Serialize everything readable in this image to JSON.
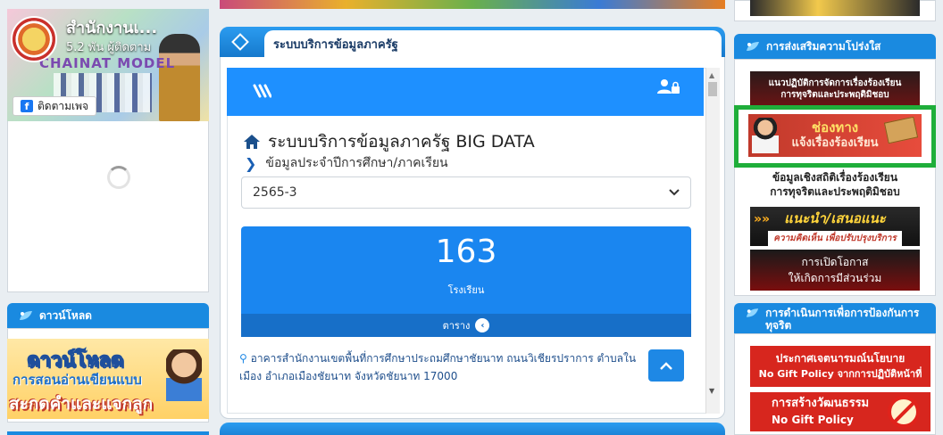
{
  "facebook": {
    "page_name": "สำนักงานเ...",
    "followers": "5.2 พัน ผู้ติดตาม",
    "cover_text": "CHAINAT MODEL",
    "follow_button": "ติดตามเพจ",
    "fb_letter": "f"
  },
  "downloads": {
    "header": "ดาวน์โหลด",
    "banner_line1": "ดาวน์โหลด",
    "banner_line2": "การสอนอ่านเขียนแบบ",
    "banner_line3": "สะกดคำและแจกลูก"
  },
  "main_panel": {
    "header": "ระบบบริการข้อมูลภาครัฐ",
    "app_title": "ระบบบริการข้อมูลภาครัฐ BIG DATA",
    "subtitle": "ข้อมูลประจำปีการศึกษา/ภาคเรียน",
    "select_value": "2565-3",
    "stat": {
      "value": "163",
      "label": "โรงเรียน",
      "footer": "ตาราง"
    },
    "address": "อาคารสำนักงานเขตพื้นที่การศึกษาประถมศึกษาชัยนาท ถนนวิเชียรปราการ ตำบลในเมือง อำเภอเมืองชัยนาท จังหวัดชัยนาท 17000"
  },
  "sidebar_right": {
    "transparency_header": "การส่งเสริมความโปร่งใส",
    "banners": [
      {
        "line1": "แนวปฏิบัติการจัดการเรื่องร้องเรียน",
        "line2": "การทุจริตและประพฤติมิชอบ"
      },
      {
        "line1": "ช่องทาง",
        "line2": "แจ้งเรื่องร้องเรียน"
      },
      {
        "line1": "ข้อมูลเชิงสถิติเรื่องร้องเรียน",
        "line2": "การทุจริตและประพฤติมิชอบ"
      },
      {
        "line1": "แนะนำ/เสนอแนะ",
        "line2": "ความคิดเห็น เพื่อปรับปรุงบริการ"
      },
      {
        "line1": "การเปิดโอกาส",
        "line2": "ให้เกิดการมีส่วนร่วม"
      }
    ],
    "anticorruption_header": "การดำเนินการเพื่อการป้องกันการทุจริต",
    "anticorruption_banners": [
      {
        "line1": "ประกาศเจตนารมณ์นโยบาย",
        "line2": "No Gift Policy จากการปฏิบัติหน้าที่"
      },
      {
        "line1": "การสร้างวัฒนธรรม",
        "line2": "No Gift Policy"
      }
    ]
  },
  "colors": {
    "primary_blue": "#1a8ae0",
    "highlight_green": "#1fae3a",
    "banner_red": "#d7261e"
  },
  "icons": [
    "spinner-icon",
    "diamond-icon",
    "home-icon",
    "chevron-right-icon",
    "user-lock-icon",
    "menu-stripes-icon",
    "chevron-up-icon",
    "map-pin-icon",
    "leaf-icon"
  ]
}
